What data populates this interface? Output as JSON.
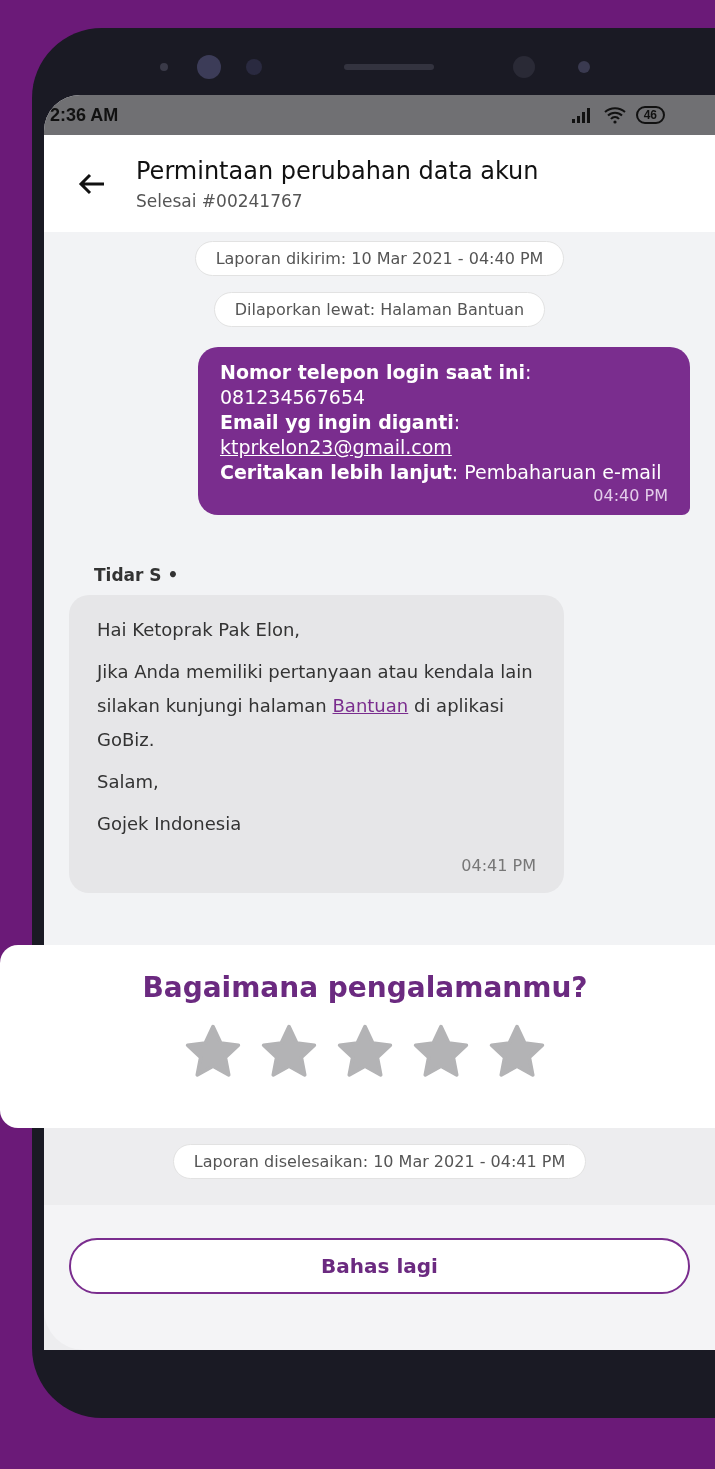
{
  "status_bar": {
    "time": "2:36 AM",
    "battery": "46"
  },
  "header": {
    "title": "Permintaan perubahan data akun",
    "subtitle": "Selesai #00241767"
  },
  "pills_top": [
    "Laporan dikirim: 10 Mar 2021 - 04:40 PM",
    "Dilaporkan lewat: Halaman Bantuan"
  ],
  "sent_message": {
    "lines": [
      {
        "kind": "text",
        "text": "**Nomor telepon login saat ini**:"
      },
      {
        "kind": "text",
        "text": "081234567654"
      },
      {
        "kind": "text",
        "text": "**Email yg ingin diganti**:"
      },
      {
        "kind": "link",
        "text": "ktprkelon23@gmail.com"
      },
      {
        "kind": "text",
        "text": "**Ceritakan lebih lanjut**: Pembaharuan e-mail"
      }
    ],
    "time": "04:40 PM"
  },
  "sender": "Tidar S •",
  "received_message": {
    "paragraphs": [
      {
        "kind": "text",
        "text": "Hai Ketoprak Pak Elon,"
      },
      {
        "kind": "link",
        "before": "Jika Anda memiliki pertanyaan atau kendala lain silakan kunjungi halaman",
        "link": "Bantuan",
        "after": "di aplikasi GoBiz."
      },
      {
        "kind": "text",
        "text": "Salam,"
      },
      {
        "kind": "text",
        "text": "Gojek Indonesia"
      }
    ],
    "time": "04:41 PM"
  },
  "rating": {
    "title": "Bagaimana pengalamanmu?",
    "stars": 0
  },
  "pill_bottom": "Laporan diselesaikan: 10 Mar 2021 - 04:41 PM",
  "button": "Bahas lagi"
}
